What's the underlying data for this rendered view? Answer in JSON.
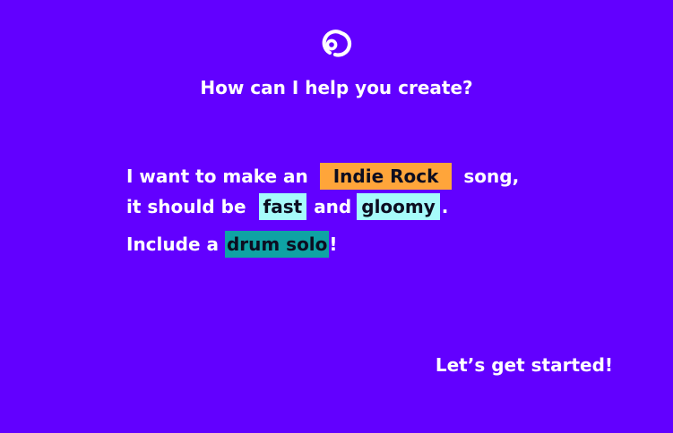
{
  "header": {
    "logo_icon": "two-circles-logo-icon",
    "title": "How can I help you create?"
  },
  "prompt": {
    "line1_prefix": "I want to make an",
    "genre": "Indie Rock",
    "line1_suffix": "song,",
    "line2_prefix": "it should be",
    "tempo": "fast",
    "line2_middle": "and",
    "mood": "gloomy",
    "line2_suffix": ".",
    "line3_prefix": "Include a",
    "feature": "drum solo",
    "line3_suffix": "!"
  },
  "cta": {
    "label": "Let’s get started!"
  },
  "colors": {
    "background": "#6200ff",
    "text": "#ffffff",
    "genre_chip": "#ffa53a",
    "tempo_chip": "#a6fbfa",
    "mood_chip": "#a6fbfa",
    "feature_chip": "#0fa3a4"
  }
}
